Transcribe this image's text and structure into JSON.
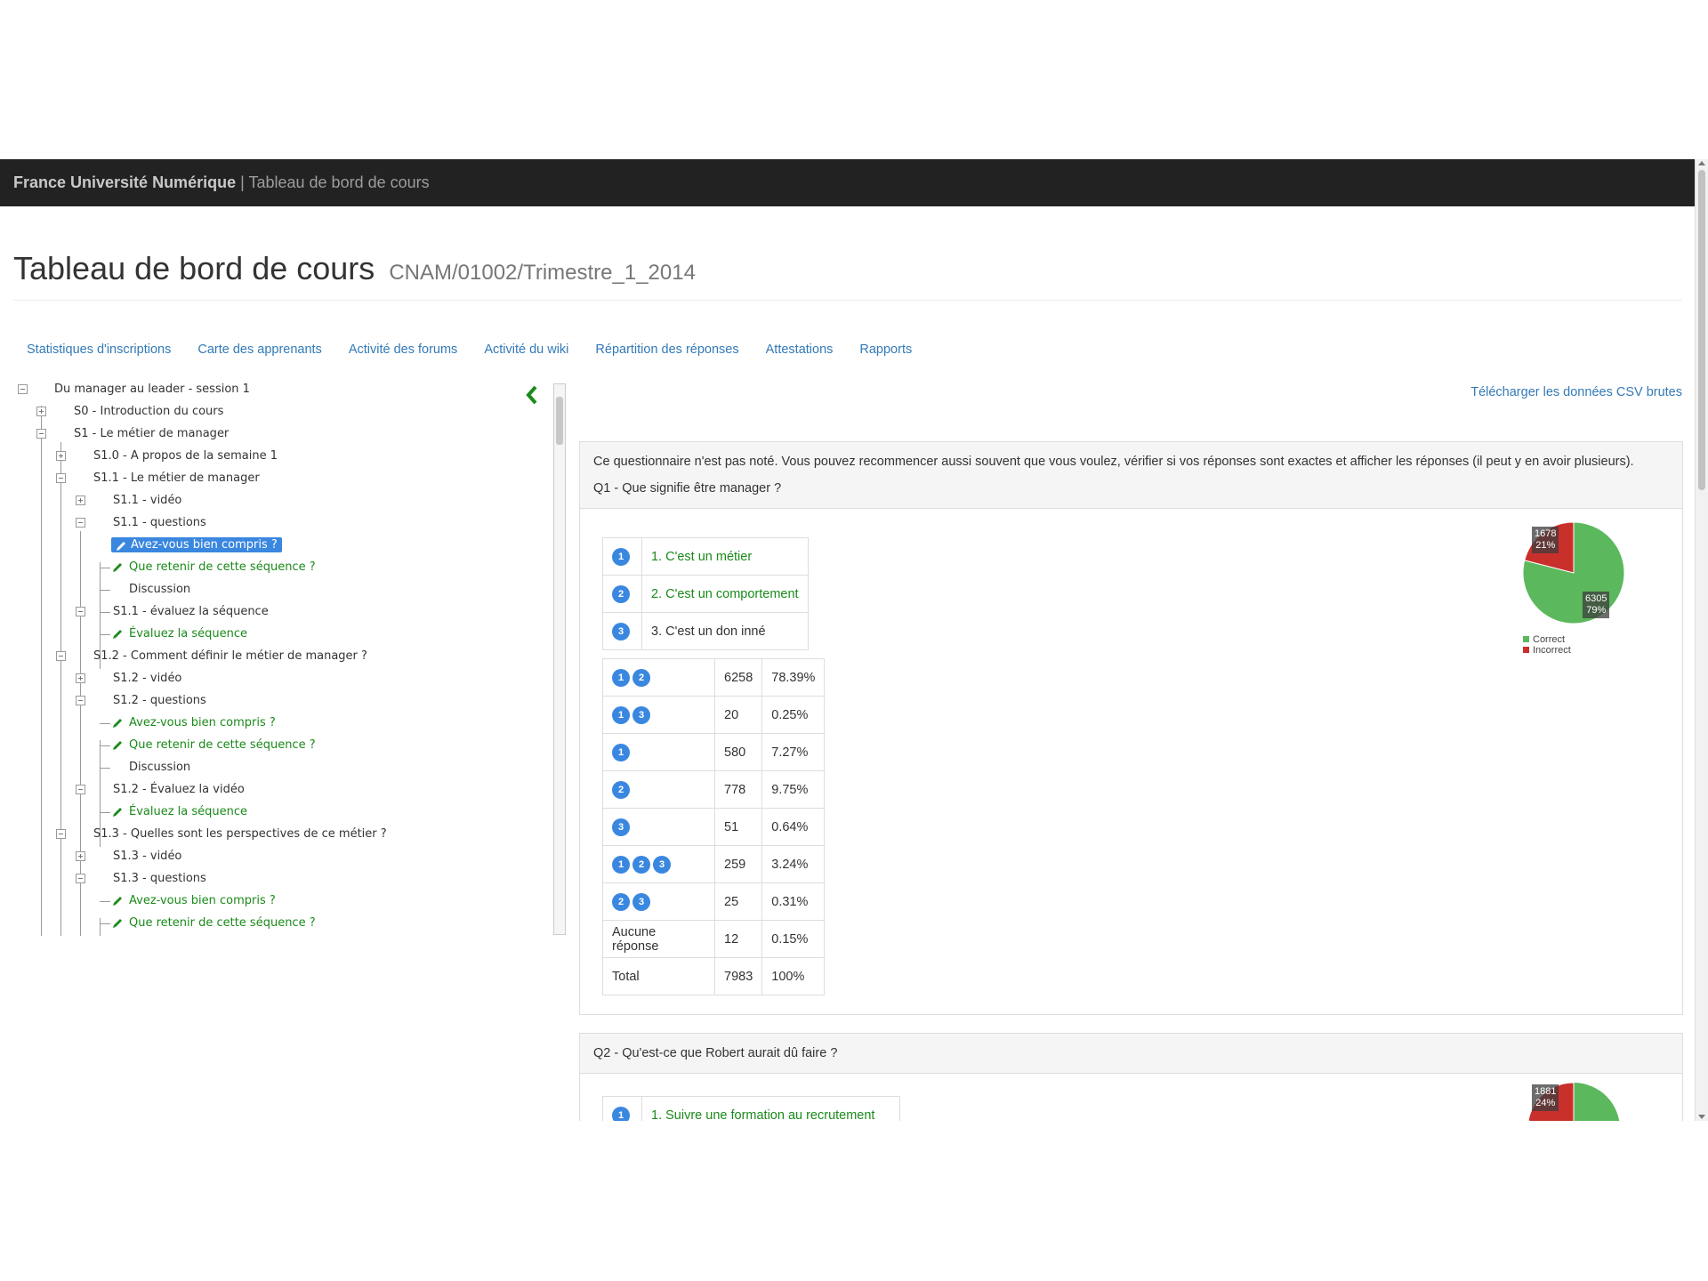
{
  "navbar": {
    "brand": "France Université Numérique",
    "separator": "|",
    "subtitle": "Tableau de bord de cours"
  },
  "page": {
    "title": "Tableau de bord de cours",
    "course_id": "CNAM/01002/Trimestre_1_2014"
  },
  "tabs": [
    "Statistiques d'inscriptions",
    "Carte des apprenants",
    "Activité des forums",
    "Activité du wiki",
    "Répartition des réponses",
    "Attestations",
    "Rapports"
  ],
  "tree": {
    "root": "Du manager au leader - session 1",
    "s0": "S0 - Introduction du cours",
    "s1": "S1 - Le métier de manager",
    "s10": "S1.0 - A propos de la semaine 1",
    "s11": "S1.1 - Le métier de manager",
    "s11_video": "S1.1 - vidéo",
    "s11_questions": "S1.1 - questions",
    "s11_q1": "Avez-vous bien compris ?",
    "s11_q2": "Que retenir de cette séquence ?",
    "s11_discussion": "Discussion",
    "s11_eval": "S1.1 - évaluez la séquence",
    "s11_eval_item": "Évaluez la séquence",
    "s12": "S1.2 - Comment définir le métier de manager ?",
    "s12_video": "S1.2 - vidéo",
    "s12_questions": "S1.2 - questions",
    "s12_q1": "Avez-vous bien compris ?",
    "s12_q2": "Que retenir de cette séquence ?",
    "s12_discussion": "Discussion",
    "s12_eval": "S1.2 - Évaluez la vidéo",
    "s12_eval_item": "Évaluez la séquence",
    "s13": "S1.3 - Quelles sont les perspectives de ce métier ?",
    "s13_video": "S1.3 - vidéo",
    "s13_questions": "S1.3 - questions",
    "s13_q1": "Avez-vous bien compris ?",
    "s13_q2": "Que retenir de cette séquence ?"
  },
  "csv_link": "Télécharger les données CSV brutes",
  "q1": {
    "intro": "Ce questionnaire n'est pas noté. Vous pouvez recommencer aussi souvent que vous voulez, vérifier si vos réponses sont exactes et afficher les réponses (il peut y en avoir plusieurs).",
    "question": "Q1 - Que signifie être manager ?",
    "choices": [
      {
        "num": "1",
        "text": "1. C'est un métier",
        "correct": true
      },
      {
        "num": "2",
        "text": "2. C'est un comportement",
        "correct": true
      },
      {
        "num": "3",
        "text": "3. C'est un don inné",
        "correct": false
      }
    ],
    "rows": [
      {
        "badges": [
          "1",
          "2"
        ],
        "count": "6258",
        "pct": "78.39%"
      },
      {
        "badges": [
          "1",
          "3"
        ],
        "count": "20",
        "pct": "0.25%"
      },
      {
        "badges": [
          "1"
        ],
        "count": "580",
        "pct": "7.27%"
      },
      {
        "badges": [
          "2"
        ],
        "count": "778",
        "pct": "9.75%"
      },
      {
        "badges": [
          "3"
        ],
        "count": "51",
        "pct": "0.64%"
      },
      {
        "badges": [
          "1",
          "2",
          "3"
        ],
        "count": "259",
        "pct": "3.24%"
      },
      {
        "badges": [
          "2",
          "3"
        ],
        "count": "25",
        "pct": "0.31%"
      },
      {
        "label": "Aucune réponse",
        "count": "12",
        "pct": "0.15%"
      },
      {
        "label": "Total",
        "count": "7983",
        "pct": "100%"
      }
    ],
    "pie": {
      "incorrect_count": "1678",
      "incorrect_pct": "21%",
      "incorrect_value": 1678,
      "correct_count": "6305",
      "correct_pct": "79%",
      "correct_value": 6305
    }
  },
  "q2": {
    "question": "Q2 - Qu'est-ce que Robert aurait dû faire ?",
    "first_choice_num": "1",
    "first_choice": "1. Suivre une formation au recrutement",
    "pie": {
      "incorrect_count": "1881",
      "incorrect_pct": "24%"
    }
  },
  "legend": {
    "correct": "Correct",
    "incorrect": "Incorrect"
  },
  "colors": {
    "correct": "#5cb85c",
    "incorrect": "#c9302c",
    "accent": "#3a87e0",
    "link": "#337ab7",
    "navbar": "#222222"
  }
}
